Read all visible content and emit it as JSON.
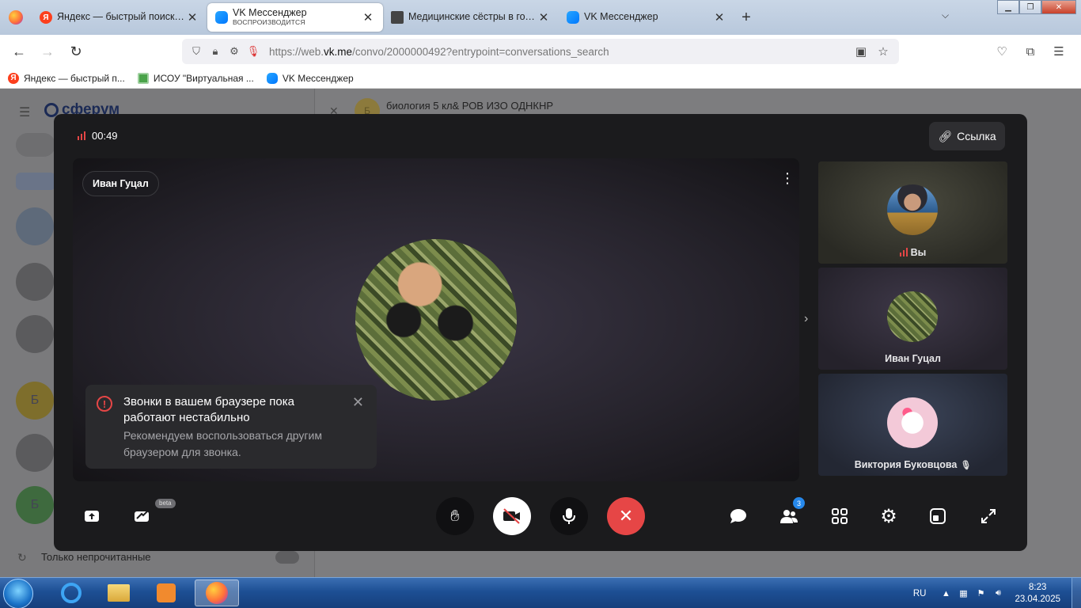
{
  "browser": {
    "tabs": [
      {
        "title": "Яндекс — быстрый поиск в интернете",
        "favicon": "yandex-icon",
        "active": false
      },
      {
        "title": "VK Мессенджер",
        "subtitle": "ВОСПРОИЗВОДИТСЯ",
        "favicon": "vk-icon",
        "active": true
      },
      {
        "title": "Медицинские сёстры в годы Великой",
        "favicon": "pdf-icon",
        "active": false
      },
      {
        "title": "VK Мессенджер",
        "favicon": "vk-icon",
        "active": false
      }
    ],
    "new_tab": "+",
    "url": {
      "prefix": "https://web.",
      "domain": "vk.me",
      "path": "/convo/2000000492?entrypoint=conversations_search"
    },
    "bookmarks": [
      {
        "label": "Яндекс — быстрый п...",
        "icon": "yandex-icon"
      },
      {
        "label": "ИСОУ \"Виртуальная ...",
        "icon": "isou-icon"
      },
      {
        "label": "VK Мессенджер",
        "icon": "vk-icon"
      }
    ]
  },
  "background_page": {
    "brand": "сферум",
    "chat_title": "биология 5 кл& РОВ ИЗО ОДНКНР",
    "chat_avatar_letter": "Б",
    "only_unread_label": "Только непрочитанные",
    "avatar_letters": [
      "Б",
      "Б"
    ]
  },
  "call": {
    "timer": "00:49",
    "link_button": "Ссылка",
    "main_participant": "Иван Гуцал",
    "toast": {
      "title": "Звонки в вашем браузере пока работают нестабильно",
      "body": "Рекомендуем воспользоваться другим браузером для звонка."
    },
    "participants": [
      {
        "name": "Вы",
        "signal_icon": true
      },
      {
        "name": "Иван Гуцал"
      },
      {
        "name": "Виктория Буковцова",
        "muted": true
      }
    ],
    "beta_label": "beta",
    "participants_count": "3",
    "colors": {
      "end_call": "#e64646",
      "badge": "#2688eb",
      "modal_bg": "#1b1b1d"
    }
  },
  "taskbar": {
    "language": "RU",
    "time": "8:23",
    "date": "23.04.2025"
  }
}
